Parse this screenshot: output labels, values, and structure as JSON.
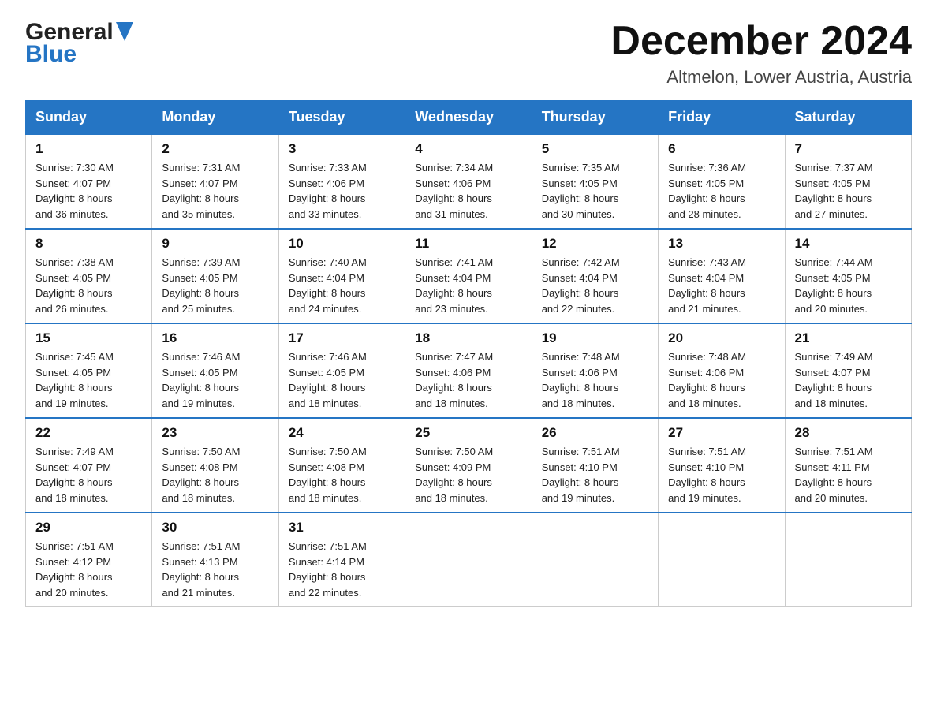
{
  "header": {
    "logo_general": "General",
    "logo_blue": "Blue",
    "month_title": "December 2024",
    "location": "Altmelon, Lower Austria, Austria"
  },
  "columns": [
    "Sunday",
    "Monday",
    "Tuesday",
    "Wednesday",
    "Thursday",
    "Friday",
    "Saturday"
  ],
  "weeks": [
    [
      {
        "day": "1",
        "sunrise": "Sunrise: 7:30 AM",
        "sunset": "Sunset: 4:07 PM",
        "daylight": "Daylight: 8 hours and 36 minutes."
      },
      {
        "day": "2",
        "sunrise": "Sunrise: 7:31 AM",
        "sunset": "Sunset: 4:07 PM",
        "daylight": "Daylight: 8 hours and 35 minutes."
      },
      {
        "day": "3",
        "sunrise": "Sunrise: 7:33 AM",
        "sunset": "Sunset: 4:06 PM",
        "daylight": "Daylight: 8 hours and 33 minutes."
      },
      {
        "day": "4",
        "sunrise": "Sunrise: 7:34 AM",
        "sunset": "Sunset: 4:06 PM",
        "daylight": "Daylight: 8 hours and 31 minutes."
      },
      {
        "day": "5",
        "sunrise": "Sunrise: 7:35 AM",
        "sunset": "Sunset: 4:05 PM",
        "daylight": "Daylight: 8 hours and 30 minutes."
      },
      {
        "day": "6",
        "sunrise": "Sunrise: 7:36 AM",
        "sunset": "Sunset: 4:05 PM",
        "daylight": "Daylight: 8 hours and 28 minutes."
      },
      {
        "day": "7",
        "sunrise": "Sunrise: 7:37 AM",
        "sunset": "Sunset: 4:05 PM",
        "daylight": "Daylight: 8 hours and 27 minutes."
      }
    ],
    [
      {
        "day": "8",
        "sunrise": "Sunrise: 7:38 AM",
        "sunset": "Sunset: 4:05 PM",
        "daylight": "Daylight: 8 hours and 26 minutes."
      },
      {
        "day": "9",
        "sunrise": "Sunrise: 7:39 AM",
        "sunset": "Sunset: 4:05 PM",
        "daylight": "Daylight: 8 hours and 25 minutes."
      },
      {
        "day": "10",
        "sunrise": "Sunrise: 7:40 AM",
        "sunset": "Sunset: 4:04 PM",
        "daylight": "Daylight: 8 hours and 24 minutes."
      },
      {
        "day": "11",
        "sunrise": "Sunrise: 7:41 AM",
        "sunset": "Sunset: 4:04 PM",
        "daylight": "Daylight: 8 hours and 23 minutes."
      },
      {
        "day": "12",
        "sunrise": "Sunrise: 7:42 AM",
        "sunset": "Sunset: 4:04 PM",
        "daylight": "Daylight: 8 hours and 22 minutes."
      },
      {
        "day": "13",
        "sunrise": "Sunrise: 7:43 AM",
        "sunset": "Sunset: 4:04 PM",
        "daylight": "Daylight: 8 hours and 21 minutes."
      },
      {
        "day": "14",
        "sunrise": "Sunrise: 7:44 AM",
        "sunset": "Sunset: 4:05 PM",
        "daylight": "Daylight: 8 hours and 20 minutes."
      }
    ],
    [
      {
        "day": "15",
        "sunrise": "Sunrise: 7:45 AM",
        "sunset": "Sunset: 4:05 PM",
        "daylight": "Daylight: 8 hours and 19 minutes."
      },
      {
        "day": "16",
        "sunrise": "Sunrise: 7:46 AM",
        "sunset": "Sunset: 4:05 PM",
        "daylight": "Daylight: 8 hours and 19 minutes."
      },
      {
        "day": "17",
        "sunrise": "Sunrise: 7:46 AM",
        "sunset": "Sunset: 4:05 PM",
        "daylight": "Daylight: 8 hours and 18 minutes."
      },
      {
        "day": "18",
        "sunrise": "Sunrise: 7:47 AM",
        "sunset": "Sunset: 4:06 PM",
        "daylight": "Daylight: 8 hours and 18 minutes."
      },
      {
        "day": "19",
        "sunrise": "Sunrise: 7:48 AM",
        "sunset": "Sunset: 4:06 PM",
        "daylight": "Daylight: 8 hours and 18 minutes."
      },
      {
        "day": "20",
        "sunrise": "Sunrise: 7:48 AM",
        "sunset": "Sunset: 4:06 PM",
        "daylight": "Daylight: 8 hours and 18 minutes."
      },
      {
        "day": "21",
        "sunrise": "Sunrise: 7:49 AM",
        "sunset": "Sunset: 4:07 PM",
        "daylight": "Daylight: 8 hours and 18 minutes."
      }
    ],
    [
      {
        "day": "22",
        "sunrise": "Sunrise: 7:49 AM",
        "sunset": "Sunset: 4:07 PM",
        "daylight": "Daylight: 8 hours and 18 minutes."
      },
      {
        "day": "23",
        "sunrise": "Sunrise: 7:50 AM",
        "sunset": "Sunset: 4:08 PM",
        "daylight": "Daylight: 8 hours and 18 minutes."
      },
      {
        "day": "24",
        "sunrise": "Sunrise: 7:50 AM",
        "sunset": "Sunset: 4:08 PM",
        "daylight": "Daylight: 8 hours and 18 minutes."
      },
      {
        "day": "25",
        "sunrise": "Sunrise: 7:50 AM",
        "sunset": "Sunset: 4:09 PM",
        "daylight": "Daylight: 8 hours and 18 minutes."
      },
      {
        "day": "26",
        "sunrise": "Sunrise: 7:51 AM",
        "sunset": "Sunset: 4:10 PM",
        "daylight": "Daylight: 8 hours and 19 minutes."
      },
      {
        "day": "27",
        "sunrise": "Sunrise: 7:51 AM",
        "sunset": "Sunset: 4:10 PM",
        "daylight": "Daylight: 8 hours and 19 minutes."
      },
      {
        "day": "28",
        "sunrise": "Sunrise: 7:51 AM",
        "sunset": "Sunset: 4:11 PM",
        "daylight": "Daylight: 8 hours and 20 minutes."
      }
    ],
    [
      {
        "day": "29",
        "sunrise": "Sunrise: 7:51 AM",
        "sunset": "Sunset: 4:12 PM",
        "daylight": "Daylight: 8 hours and 20 minutes."
      },
      {
        "day": "30",
        "sunrise": "Sunrise: 7:51 AM",
        "sunset": "Sunset: 4:13 PM",
        "daylight": "Daylight: 8 hours and 21 minutes."
      },
      {
        "day": "31",
        "sunrise": "Sunrise: 7:51 AM",
        "sunset": "Sunset: 4:14 PM",
        "daylight": "Daylight: 8 hours and 22 minutes."
      },
      null,
      null,
      null,
      null
    ]
  ]
}
